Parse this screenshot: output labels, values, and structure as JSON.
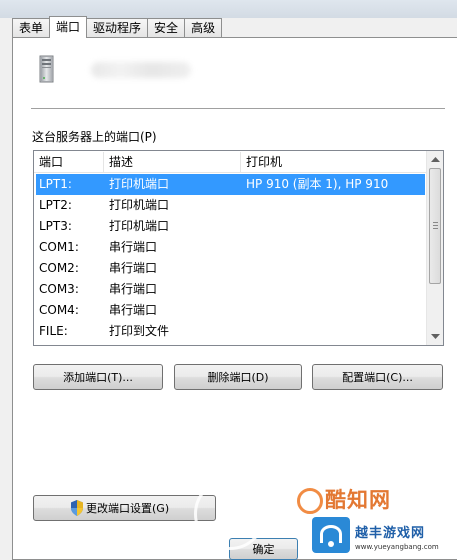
{
  "tabs": [
    {
      "label": "表单",
      "active": false
    },
    {
      "label": "端口",
      "active": true
    },
    {
      "label": "驱动程序",
      "active": false
    },
    {
      "label": "安全",
      "active": false
    },
    {
      "label": "高级",
      "active": false
    }
  ],
  "header": {
    "server_icon": "server-icon"
  },
  "ports_section": {
    "label": "这台服务器上的端口(P)"
  },
  "table": {
    "columns": [
      "端口",
      "描述",
      "打印机"
    ],
    "rows": [
      {
        "port": "LPT1:",
        "description": "打印机端口",
        "printer": "HP 910 (副本 1), HP 910",
        "selected": true
      },
      {
        "port": "LPT2:",
        "description": "打印机端口",
        "printer": "",
        "selected": false
      },
      {
        "port": "LPT3:",
        "description": "打印机端口",
        "printer": "",
        "selected": false
      },
      {
        "port": "COM1:",
        "description": "串行端口",
        "printer": "",
        "selected": false
      },
      {
        "port": "COM2:",
        "description": "串行端口",
        "printer": "",
        "selected": false
      },
      {
        "port": "COM3:",
        "description": "串行端口",
        "printer": "",
        "selected": false
      },
      {
        "port": "COM4:",
        "description": "串行端口",
        "printer": "",
        "selected": false
      },
      {
        "port": "FILE:",
        "description": "打印到文件",
        "printer": "",
        "selected": false
      }
    ],
    "selection_color": "#3399ff"
  },
  "buttons": {
    "add_port": "添加端口(T)...",
    "delete_port": "删除端口(D)",
    "configure_port": "配置端口(C)...",
    "change_port_settings": "更改端口设置(G)",
    "ok": "确定"
  },
  "watermark": {
    "brand": "酷知网",
    "site": "越丰游戏网",
    "url": "www.yueyangbang.com"
  }
}
